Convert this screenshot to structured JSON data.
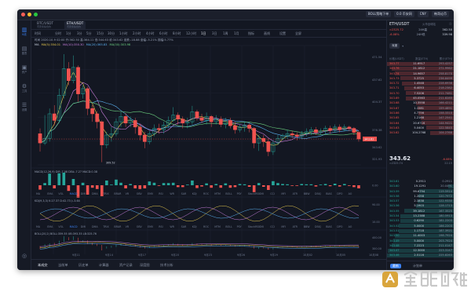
{
  "titlebar": {
    "pills": [
      "BOLL策略下单",
      "0.0 币安网",
      "CNY",
      "韩哥论币"
    ]
  },
  "sidebar": {
    "items": [
      {
        "label": "K线",
        "icon": "candlestick-icon",
        "active": true
      },
      {
        "label": "图表",
        "icon": "chart-icon",
        "active": false
      },
      {
        "label": "资产",
        "icon": "wallet-icon",
        "active": false
      },
      {
        "label": "工具",
        "icon": "tools-icon",
        "active": false
      },
      {
        "label": "设置",
        "icon": "gear-icon",
        "active": false
      }
    ]
  },
  "tabs": [
    {
      "label": "BTC/USDT",
      "sub": "币安永续合约"
    },
    {
      "label": "ETH/USDT",
      "sub": "币安永续合约"
    }
  ],
  "toolbar": {
    "items": [
      "时间",
      "分时",
      "1分",
      "3分",
      "5分",
      "15分",
      "30分",
      "1小时",
      "2小时",
      "4小时",
      "6小时",
      "8小时",
      "12小时",
      "1日",
      "3日",
      "1周",
      "1月"
    ],
    "active_index": 13,
    "extra": [
      "指标",
      "画线",
      "设置",
      "全屏"
    ]
  },
  "ohlc": "时间 2020-10-9 02:00 开:362.50 高:364.11 低:344.63 收:343.62 涨跌:-18.88 涨幅:-5.21% 振幅:5.77%",
  "ma_legend": {
    "label": "MA",
    "items": [
      {
        "text": "MA(5):354.01",
        "color": "#e6c84d"
      },
      {
        "text": "MA(10):350.30",
        "color": "#c77ddb"
      },
      {
        "text": "MA(20):365.83",
        "color": "#5ab0f0"
      },
      {
        "text": "MA(30):303.98",
        "color": "#6bcf7f"
      }
    ]
  },
  "price_axis": [
    "471.54",
    "437.62",
    "404.37",
    "376.38",
    "343.62",
    "321.93"
  ],
  "last_price_tag": "343.62",
  "low_tag": "309.52",
  "indicators": {
    "macd": "MACD(12,26,9)  DIF:-7.08  DEA:-7.27  MACD:0.38",
    "macd_axis": "0.00",
    "kdj": "KDJ(9,3,3)  K:27.37  D:42.73  J:-3.64",
    "kdj_axis": [
      "90.00",
      "10.00"
    ],
    "boll": "BOLL(20,2)  BOLL:359.55  UB:393.35  LB:325.76",
    "boll_axis": [
      "400.00",
      "300.00"
    ]
  },
  "indicator_tabs": [
    "MA",
    "EMA",
    "VOL",
    "MACD",
    "DMI",
    "DMA",
    "TRIX",
    "BRAR",
    "VR",
    "OBV",
    "EMV",
    "RSI",
    "WR",
    "SAR",
    "KDJ",
    "ROC",
    "MTM",
    "BOLL",
    "PSY",
    "StochRSI",
    "SMI",
    "CCI",
    "MFI",
    "ATR",
    "BBW",
    "DSKJ",
    "BIAS",
    "DPO",
    "AO"
  ],
  "x_dates": [
    "9月11",
    "9月14",
    "9月17",
    "9月20",
    "9月23",
    "9月26",
    "9月29",
    "10月02",
    "10月05",
    "10月08"
  ],
  "bottom_tabs": [
    "本成交",
    "当前单",
    "历史单",
    "计算器",
    "资产记录",
    "深度图",
    "技术分析"
  ],
  "ticker": [
    {
      "name": "CME比特币期货CFD-季度",
      "price": "$10875.00",
      "chg": "-3.49%",
      "dir": "neg"
    },
    {
      "name": "USDT/人民币-火币全球站",
      "price": "¥6.76",
      "chg": "+0.59%",
      "dir": "pos"
    },
    {
      "name": "比特币 - 全球指数",
      "price": "$10904.24",
      "chg": "-4.20%",
      "dir": "neg"
    },
    {
      "name": "以太坊 - 全球指数",
      "price": "$343.66",
      "chg": "-5.90%",
      "dir": "neg"
    }
  ],
  "right_panel": {
    "symbol": "ETH/USDT",
    "exchange": "火币全球站",
    "price_line": "≈2325.72",
    "change": "-6.08%",
    "high_label": "24H高",
    "high": "362.50",
    "low_label": "24H低",
    "low": "339.98",
    "depth_label": "深度",
    "ob_cols": [
      "价格(USDT)",
      "数量(ETH)",
      "累计(ETH)"
    ],
    "asks": [
      [
        "343.77",
        "11.6917",
        "293.4257"
      ],
      [
        "343.76",
        "21.1812",
        "271.9962"
      ],
      [
        "343.74",
        "14.9657",
        "258.8170"
      ],
      [
        "343.73",
        "5.3725",
        "236.8499"
      ],
      [
        "343.72",
        "1.4548",
        "228.6936"
      ],
      [
        "343.71",
        "6.4053",
        "218.2382"
      ],
      [
        "343.70",
        "7.5206",
        "211.7481"
      ],
      [
        "343.69",
        "45.0563",
        "211.8285"
      ],
      [
        "343.68",
        "10.3558",
        "166.4211"
      ],
      [
        "343.67",
        "1.1581",
        "159.4891"
      ],
      [
        "343.66",
        "4.7756",
        "158.3310"
      ],
      [
        "343.65",
        "1.2168",
        "147.2541"
      ],
      [
        "343.64",
        "20.6716",
        "144.9421"
      ],
      [
        "343.63",
        "5.0400",
        "122.5845"
      ],
      [
        "343.62",
        "104.2768",
        "104.2768"
      ]
    ],
    "last_price": "343.62",
    "last_cny": "≈2325.74",
    "last_change": "-6.08%",
    "last_vol": "22.15",
    "bids": [
      [
        "343.61",
        "0.2911",
        "0.2911"
      ],
      [
        "343.60",
        "19.1291",
        "20.0491"
      ],
      [
        "343.59",
        "99.6794",
        "119.5914"
      ],
      [
        "343.58",
        "1.2058",
        "120.7972"
      ],
      [
        "343.57",
        "2.1838",
        "122.9330"
      ],
      [
        "343.56",
        "5.1903",
        "128.1713"
      ],
      [
        "343.55",
        "39.1812",
        "167.3525"
      ],
      [
        "343.54",
        "13.2388",
        "180.5913"
      ],
      [
        "343.53",
        "0.6290",
        "181.2203"
      ],
      [
        "343.52",
        "5.0000",
        "186.2203"
      ],
      [
        "343.51",
        "1.1718",
        "187.3921"
      ],
      [
        "343.50",
        "11.4003",
        "198.7924"
      ],
      [
        "343.49",
        "5.0000",
        "203.7924"
      ],
      [
        "343.48",
        "7.2223",
        "211.0147"
      ],
      [
        "343.47",
        "12.3000",
        "223.3147"
      ],
      [
        "343.46",
        "2.5116",
        "225.8263"
      ]
    ],
    "bottom_tabs": [
      "最新",
      "计划单"
    ]
  },
  "colors": {
    "up": "#26a69a",
    "down": "#ef5350",
    "accent": "#3b82f6"
  },
  "chart_data": {
    "type": "candlestick",
    "series": [
      {
        "name": "ETH/USDT",
        "values": [
          [
            352,
            338,
            360,
            325
          ],
          [
            338,
            345,
            380,
            335
          ],
          [
            345,
            382,
            390,
            340
          ],
          [
            382,
            372,
            395,
            365
          ],
          [
            372,
            410,
            420,
            368
          ],
          [
            410,
            450,
            472,
            405
          ],
          [
            450,
            432,
            460,
            425
          ],
          [
            432,
            452,
            470,
            428
          ],
          [
            452,
            412,
            455,
            400
          ],
          [
            412,
            420,
            425,
            405
          ],
          [
            420,
            390,
            423,
            380
          ],
          [
            390,
            382,
            395,
            370
          ],
          [
            382,
            370,
            386,
            360
          ],
          [
            370,
            335,
            372,
            309
          ],
          [
            335,
            350,
            355,
            330
          ],
          [
            350,
            352,
            362,
            340
          ],
          [
            352,
            370,
            375,
            348
          ],
          [
            370,
            378,
            385,
            362
          ],
          [
            378,
            368,
            383,
            362
          ],
          [
            368,
            372,
            378,
            362
          ],
          [
            372,
            362,
            376,
            352
          ],
          [
            362,
            350,
            366,
            342
          ],
          [
            350,
            340,
            355,
            330
          ],
          [
            340,
            352,
            356,
            336
          ],
          [
            352,
            360,
            366,
            348
          ],
          [
            360,
            358,
            367,
            352
          ],
          [
            358,
            365,
            370,
            352
          ],
          [
            365,
            372,
            378,
            360
          ],
          [
            372,
            380,
            392,
            370
          ],
          [
            380,
            374,
            384,
            366
          ],
          [
            374,
            368,
            378,
            360
          ],
          [
            368,
            370,
            376,
            360
          ],
          [
            370,
            385,
            394,
            366
          ],
          [
            385,
            376,
            388,
            372
          ],
          [
            376,
            372,
            382,
            368
          ],
          [
            372,
            378,
            384,
            366
          ],
          [
            378,
            370,
            380,
            362
          ],
          [
            370,
            374,
            380,
            366
          ],
          [
            374,
            366,
            378,
            362
          ],
          [
            366,
            372,
            376,
            360
          ],
          [
            372,
            364,
            376,
            360
          ],
          [
            364,
            358,
            370,
            352
          ],
          [
            358,
            362,
            366,
            354
          ],
          [
            362,
            365,
            370,
            355
          ],
          [
            365,
            360,
            368,
            354
          ],
          [
            360,
            338,
            362,
            330
          ],
          [
            338,
            345,
            350,
            326
          ],
          [
            345,
            340,
            350,
            332
          ],
          [
            340,
            325,
            345,
            318
          ],
          [
            325,
            338,
            342,
            320
          ],
          [
            338,
            345,
            350,
            335
          ],
          [
            345,
            349,
            352,
            342
          ],
          [
            349,
            352,
            358,
            344
          ],
          [
            352,
            350,
            356,
            346
          ],
          [
            350,
            348,
            354,
            342
          ],
          [
            348,
            352,
            356,
            344
          ],
          [
            352,
            355,
            360,
            348
          ],
          [
            355,
            358,
            362,
            350
          ],
          [
            358,
            354,
            362,
            350
          ],
          [
            354,
            356,
            360,
            350
          ],
          [
            356,
            360,
            364,
            352
          ],
          [
            360,
            357,
            364,
            352
          ],
          [
            357,
            362,
            366,
            354
          ],
          [
            362,
            358,
            366,
            354
          ],
          [
            358,
            362,
            366,
            356
          ],
          [
            362,
            360,
            364,
            356
          ],
          [
            360,
            354,
            362,
            350
          ],
          [
            354,
            344,
            356,
            340
          ]
        ]
      }
    ],
    "value_order": [
      "open",
      "close",
      "high",
      "low"
    ],
    "ylim": [
      305,
      485
    ]
  }
}
